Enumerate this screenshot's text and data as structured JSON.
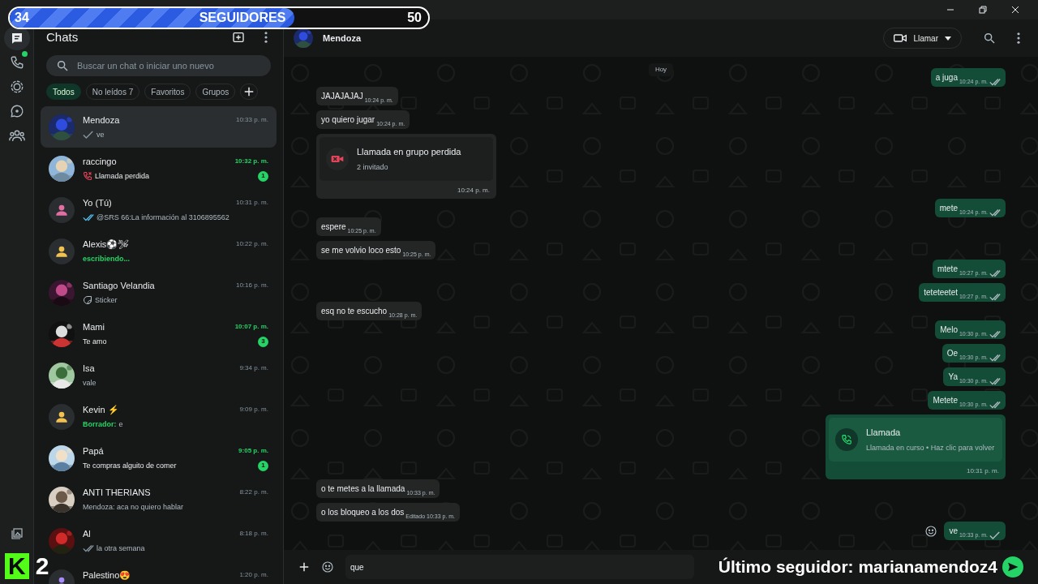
{
  "overlay": {
    "follower_goal": {
      "current": "34",
      "label": "SEGUIDORES",
      "goal": "50",
      "level": 0.68
    },
    "logo": "K",
    "logo_count": "2",
    "last_follower": "Último seguidor: marianamendoz4"
  },
  "rail": {
    "items": [
      {
        "kind": "chats",
        "selected": true,
        "dot": false
      },
      {
        "kind": "calls",
        "selected": false,
        "dot": true
      },
      {
        "kind": "status",
        "selected": false,
        "dot": false
      },
      {
        "kind": "channels",
        "selected": false,
        "dot": false
      },
      {
        "kind": "communities",
        "selected": false,
        "dot": false
      }
    ]
  },
  "sidebar": {
    "title": "Chats",
    "search": {
      "placeholder": "Buscar un chat o iniciar uno nuevo"
    },
    "filters": [
      {
        "label": "Todos",
        "selected": true
      },
      {
        "label": "No leídos 7",
        "selected": false
      },
      {
        "label": "Favoritos",
        "selected": false
      },
      {
        "label": "Grupos",
        "selected": false
      }
    ],
    "chats": [
      {
        "kind": "sent",
        "name": "Mendoza",
        "time": "10:33 p. m.",
        "preview": "ve",
        "selected": true
      },
      {
        "kind": "missed_call",
        "name": "raccingo",
        "time": "10:32 p. m.",
        "preview": "Llamada perdida",
        "unread": "1",
        "selected": false
      },
      {
        "kind": "read",
        "name": "Yo (Tú)",
        "time": "10:31 p. m.",
        "preview": "@SRS 66:La información al 3106895562",
        "avatar": {
          "kind": "placeholder",
          "color": "#e26fa4"
        },
        "selected": false
      },
      {
        "kind": "typing",
        "name": "Alexis⚽🛩",
        "time": "10:22 p. m.",
        "preview": "escribiendo...",
        "avatar": {
          "kind": "placeholder",
          "color": "#f2c14e"
        },
        "selected": false
      },
      {
        "kind": "sticker",
        "name": "Santiago Velandia",
        "time": "10:16 p. m.",
        "preview": "Sticker",
        "selected": false
      },
      {
        "kind": "plain",
        "name": "Mami",
        "time": "10:07 p. m.",
        "preview": "Te amo",
        "unread": "3",
        "selected": false
      },
      {
        "kind": "plain",
        "name": "Isa",
        "time": "9:34 p. m.",
        "preview": "vale",
        "selected": false
      },
      {
        "kind": "draft",
        "name": "Kevin ⚡",
        "time": "9:09 p. m.",
        "draft_label": "Borrador:",
        "preview": "e",
        "avatar": {
          "kind": "placeholder",
          "color": "#f2c14e"
        },
        "selected": false
      },
      {
        "kind": "plain",
        "name": "Papá",
        "time": "9:05 p. m.",
        "preview": "Te compras alguito de comer",
        "unread": "1",
        "selected": false
      },
      {
        "kind": "plain",
        "name": "ANTI THERIANS",
        "time": "8:22 p. m.",
        "preview": "Mendoza: aca no quiero hablar",
        "selected": false
      },
      {
        "kind": "delivered",
        "name": "Al",
        "time": "8:18 p. m.",
        "preview": "la otra semana",
        "selected": false
      },
      {
        "kind": "plain",
        "name": "Palestino😍",
        "time": "1:20 p. m.",
        "avatar": {
          "kind": "placeholder",
          "color": "#a78bfa"
        },
        "selected": false
      }
    ]
  },
  "chat": {
    "contact": "Mendoza",
    "call_button": "Llamar",
    "date": "Hoy",
    "groups": [
      {
        "kind": "outgoing",
        "messages": [
          {
            "kind": "text",
            "text": "a juga",
            "time": "10:24 p. m.",
            "read": true
          }
        ]
      },
      {
        "kind": "incoming",
        "messages": [
          {
            "kind": "text",
            "text": "JAJAJAJAJ",
            "time": "10:24 p. m."
          },
          {
            "kind": "text",
            "text": "yo quiero jugar",
            "time": "10:24 p. m."
          },
          {
            "kind": "call",
            "title": "Llamada en grupo perdida",
            "subtitle": "2 invitado",
            "time": "10:24 p. m."
          }
        ]
      },
      {
        "kind": "outgoing",
        "messages": [
          {
            "kind": "text",
            "text": "mete",
            "time": "10:24 p. m.",
            "read": true
          }
        ]
      },
      {
        "kind": "incoming",
        "messages": [
          {
            "kind": "text",
            "text": "espere",
            "time": "10:25 p. m."
          },
          {
            "kind": "text",
            "text": "se me volvio loco esto",
            "time": "10:25 p. m."
          }
        ]
      },
      {
        "kind": "outgoing",
        "messages": [
          {
            "kind": "text",
            "text": "mtete",
            "time": "10:27 p. m.",
            "read": true
          },
          {
            "kind": "text",
            "text": "teteteetet",
            "time": "10:27 p. m.",
            "read": true
          }
        ]
      },
      {
        "kind": "incoming",
        "messages": [
          {
            "kind": "text",
            "text": "esq no te escucho",
            "time": "10:28 p. m."
          }
        ]
      },
      {
        "kind": "outgoing",
        "messages": [
          {
            "kind": "text",
            "text": "Melo",
            "time": "10:30 p. m.",
            "read": true
          },
          {
            "kind": "text",
            "text": "Oe",
            "time": "10:30 p. m.",
            "read": true
          },
          {
            "kind": "text",
            "text": "Ya",
            "time": "10:30 p. m.",
            "read": true
          },
          {
            "kind": "text",
            "text": "Metete",
            "time": "10:30 p. m.",
            "read": true
          },
          {
            "kind": "call",
            "title": "Llamada",
            "subtitle": "Llamada en curso • Haz clic para volver",
            "time": "10:31 p. m."
          }
        ]
      },
      {
        "kind": "incoming",
        "messages": [
          {
            "kind": "text",
            "text": "o te metes a la llamada",
            "time": "10:33 p. m."
          },
          {
            "kind": "text",
            "text": "o los bloqueo a los dos",
            "edited": "Editado",
            "time": "10:33 p. m."
          }
        ]
      },
      {
        "kind": "outgoing",
        "messages": [
          {
            "kind": "text",
            "text": "ve",
            "time": "10:33 p. m.",
            "read": false
          }
        ]
      }
    ],
    "composer": {
      "value": "que"
    }
  }
}
